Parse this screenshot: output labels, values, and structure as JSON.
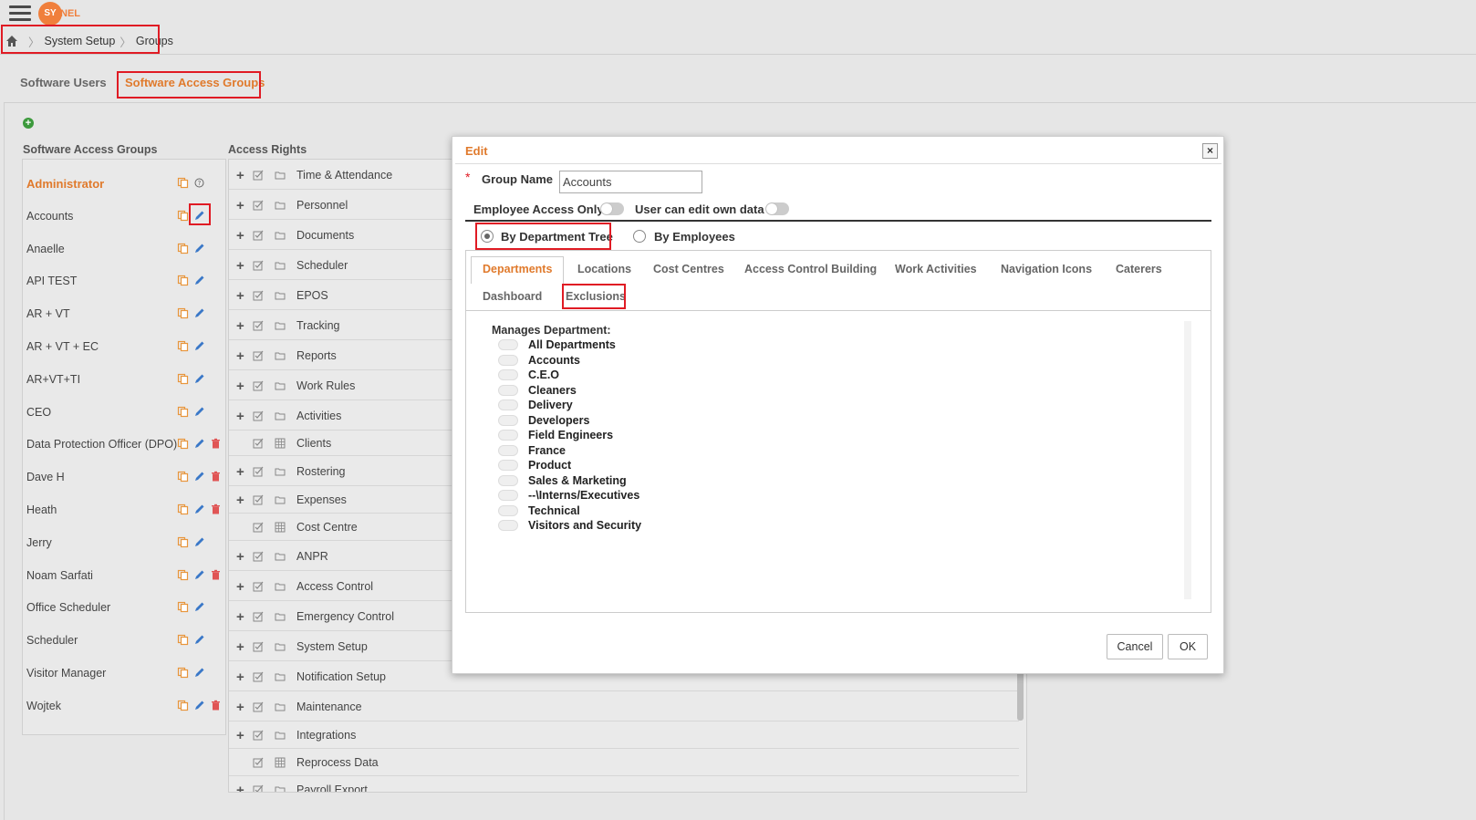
{
  "header": {
    "logo_text": "SY",
    "logo_tail": "NEL",
    "breadcrumb": [
      "System Setup",
      "Groups"
    ]
  },
  "tabs": [
    "Software Users",
    "Software Access Groups"
  ],
  "left_header": "Software Access Groups",
  "rights_header": "Access Rights",
  "groups": [
    "Administrator",
    "Accounts",
    "Anaelle",
    "API TEST",
    "AR + VT",
    "AR + VT + EC",
    "AR+VT+TI",
    "CEO",
    "Data Protection Officer (DPO)",
    "Dave H",
    "Heath",
    "Jerry",
    "Noam Sarfati",
    "Office Scheduler",
    "Scheduler",
    "Visitor Manager",
    "Wojtek"
  ],
  "access_rights": [
    "Time & Attendance",
    "Personnel",
    "Documents",
    "Scheduler",
    "EPOS",
    "Tracking",
    "Reports",
    "Work Rules",
    "Activities",
    "Clients",
    "Rostering",
    "Expenses",
    "Cost Centre",
    "ANPR",
    "Access Control",
    "Emergency Control",
    "System Setup",
    "Notification Setup",
    "Maintenance",
    "Integrations",
    "Reprocess Data",
    "Payroll Export"
  ],
  "modal": {
    "title": "Edit",
    "close": "×",
    "group_name_label": "Group Name",
    "group_name_value": "Accounts",
    "employee_access_only": "Employee Access Only",
    "user_can_edit": "User can edit own data",
    "radio_dept": "By Department Tree",
    "radio_emp": "By Employees",
    "inner_tabs": [
      "Departments",
      "Locations",
      "Cost Centres",
      "Access Control Building",
      "Work Activities",
      "Navigation Icons",
      "Caterers",
      "Dashboard",
      "Exclusions"
    ],
    "manages_label": "Manages Department:",
    "departments": [
      "All Departments",
      "Accounts",
      "C.E.O",
      "Cleaners",
      "Delivery",
      "Developers",
      "Field Engineers",
      "France",
      "Product",
      "Sales & Marketing",
      "--\\Interns/Executives",
      "Technical",
      "Visitors and Security"
    ],
    "cancel": "Cancel",
    "ok": "OK"
  }
}
